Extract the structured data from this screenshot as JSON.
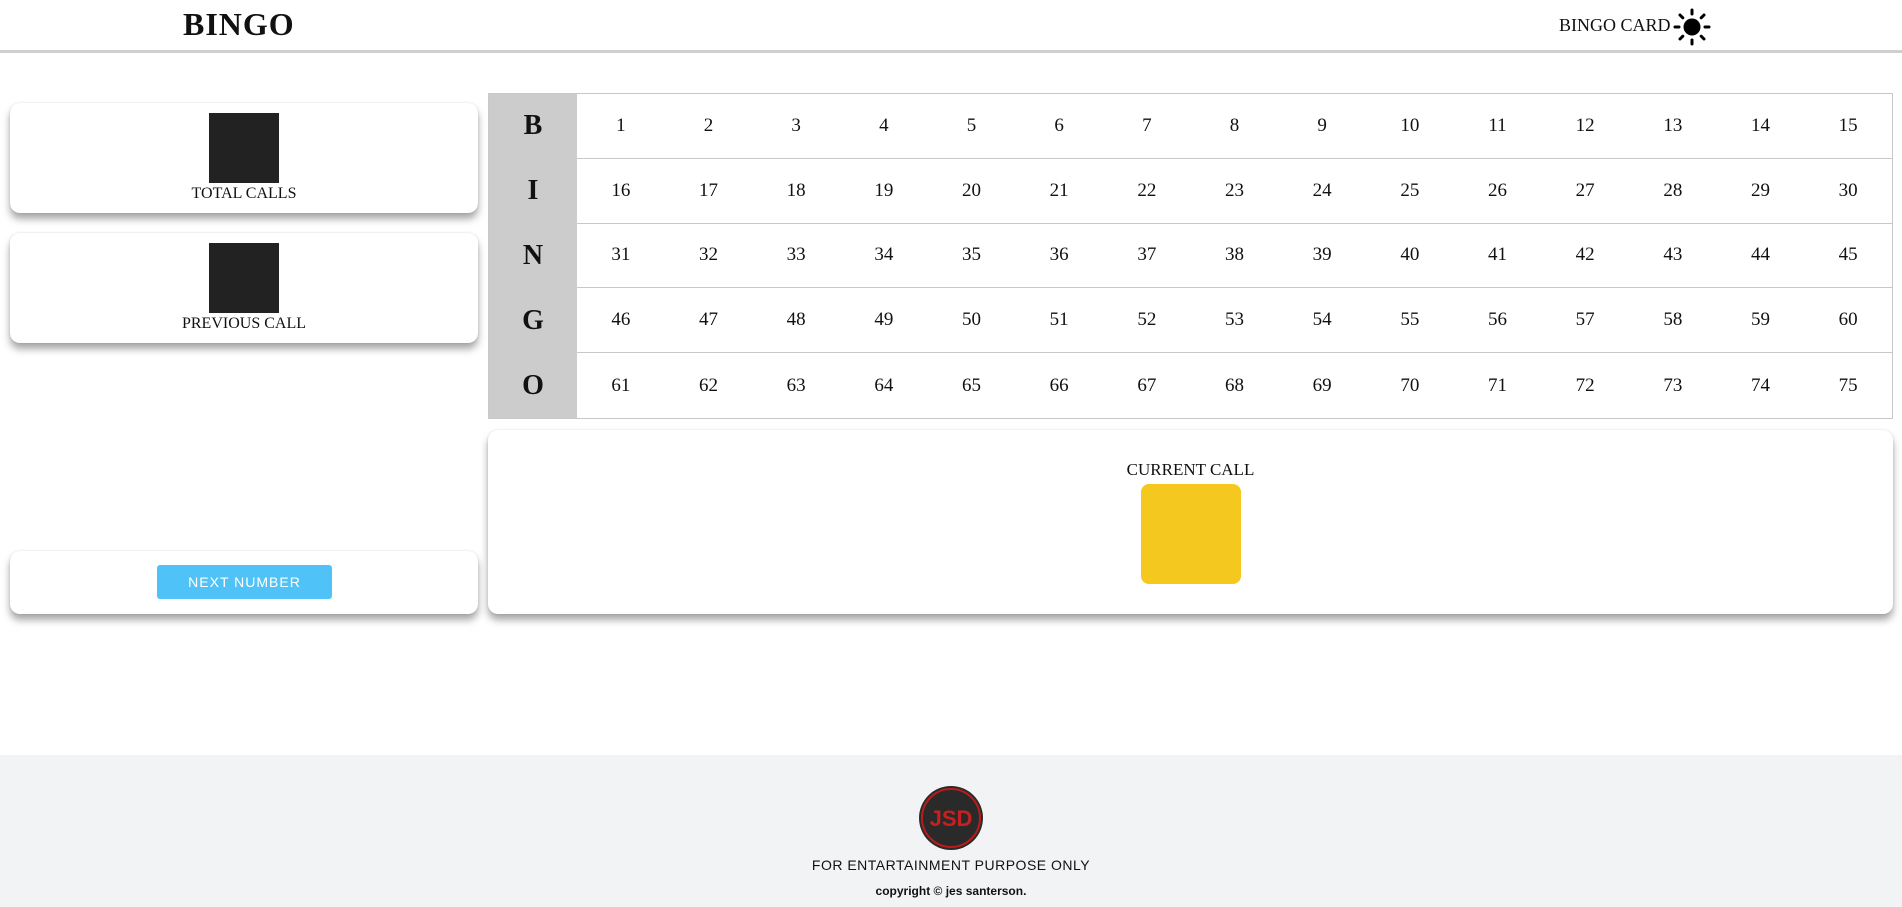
{
  "header": {
    "title": "BINGO",
    "nav_link": "BINGO CARD",
    "theme_icon": "sun-icon"
  },
  "stats": {
    "total_calls_label": "TOTAL CALLS",
    "previous_call_label": "PREVIOUS CALL"
  },
  "controls": {
    "next_button_label": "NEXT NUMBER"
  },
  "board": {
    "rows": [
      {
        "letter": "B",
        "numbers": [
          "1",
          "2",
          "3",
          "4",
          "5",
          "6",
          "7",
          "8",
          "9",
          "10",
          "11",
          "12",
          "13",
          "14",
          "15"
        ]
      },
      {
        "letter": "I",
        "numbers": [
          "16",
          "17",
          "18",
          "19",
          "20",
          "21",
          "22",
          "23",
          "24",
          "25",
          "26",
          "27",
          "28",
          "29",
          "30"
        ]
      },
      {
        "letter": "N",
        "numbers": [
          "31",
          "32",
          "33",
          "34",
          "35",
          "36",
          "37",
          "38",
          "39",
          "40",
          "41",
          "42",
          "43",
          "44",
          "45"
        ]
      },
      {
        "letter": "G",
        "numbers": [
          "46",
          "47",
          "48",
          "49",
          "50",
          "51",
          "52",
          "53",
          "54",
          "55",
          "56",
          "57",
          "58",
          "59",
          "60"
        ]
      },
      {
        "letter": "O",
        "numbers": [
          "61",
          "62",
          "63",
          "64",
          "65",
          "66",
          "67",
          "68",
          "69",
          "70",
          "71",
          "72",
          "73",
          "74",
          "75"
        ]
      }
    ]
  },
  "current": {
    "label": "CURRENT CALL",
    "color": "#f4c81e"
  },
  "footer": {
    "logo_text": "JSD",
    "note": "FOR ENTARTAINMENT PURPOSE ONLY",
    "copyright": "copyright © jes santerson."
  },
  "colors": {
    "accent_button": "#4fc3f7",
    "letter_column": "#cccccc",
    "stat_box": "#222222",
    "footer_bg": "#f2f3f5"
  }
}
